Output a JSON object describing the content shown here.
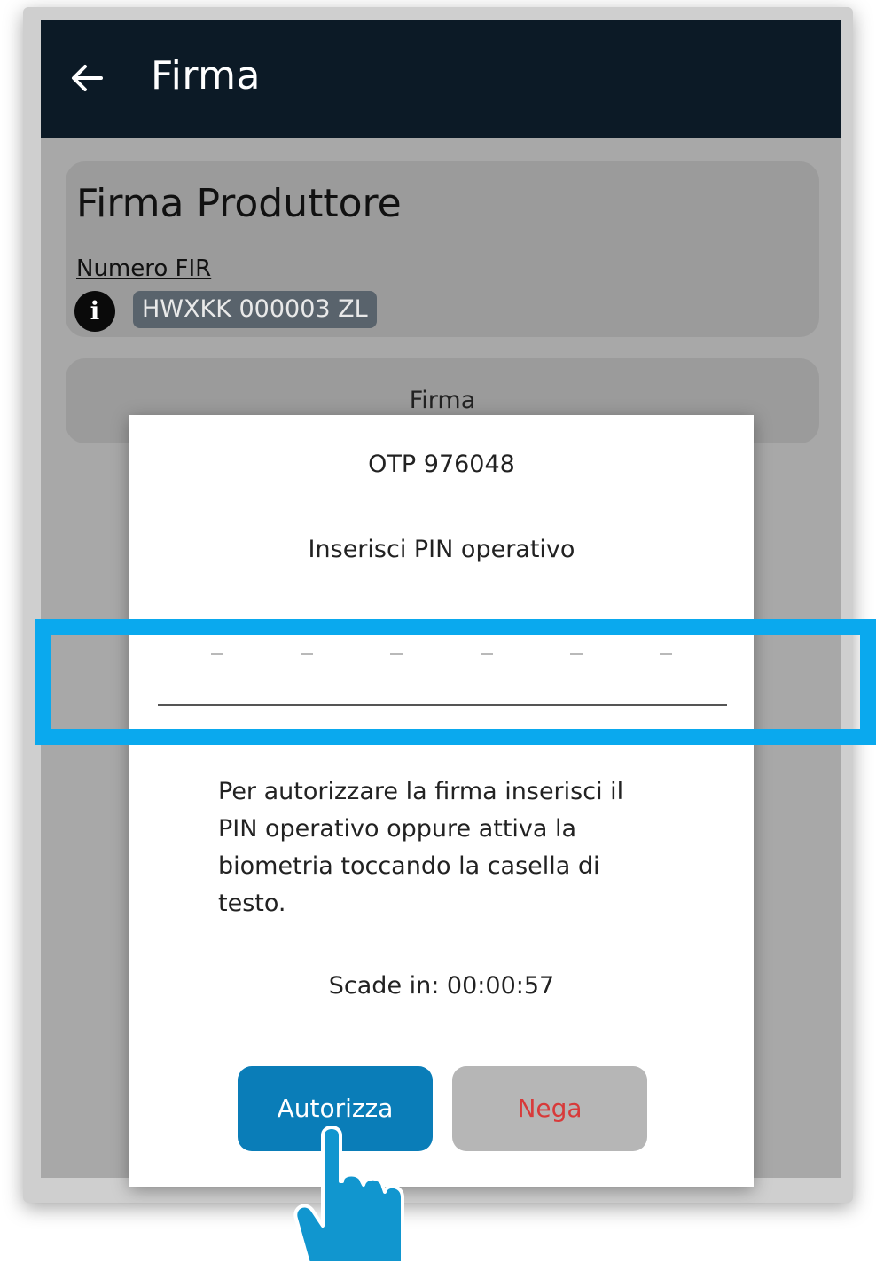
{
  "appbar": {
    "title": "Firma",
    "background": "#0c1a26"
  },
  "card": {
    "title": "Firma Produttore",
    "fir_label": "Numero FIR",
    "fir_value": "HWXKK 000003 ZL",
    "info_icon_glyph": "i"
  },
  "sign_button": {
    "label": "Firma"
  },
  "dialog": {
    "otp": "OTP 976048",
    "pin_title": "Inserisci PIN operativo",
    "description": "Per autorizzare la firma inserisci il PIN operativo oppure attiva la biometria toccando la casella di testo.",
    "expires": "Scade in: 00:00:57",
    "authorize_label": "Autorizza",
    "deny_label": "Nega",
    "pin_length": 6
  },
  "colors": {
    "highlight": "#0aa9ee",
    "authorize": "#0a7db8",
    "deny_text": "#d83a3a",
    "hand": "#1196cf"
  },
  "icons": [
    "arrow-left-icon",
    "info-icon",
    "tap-hand-icon"
  ]
}
